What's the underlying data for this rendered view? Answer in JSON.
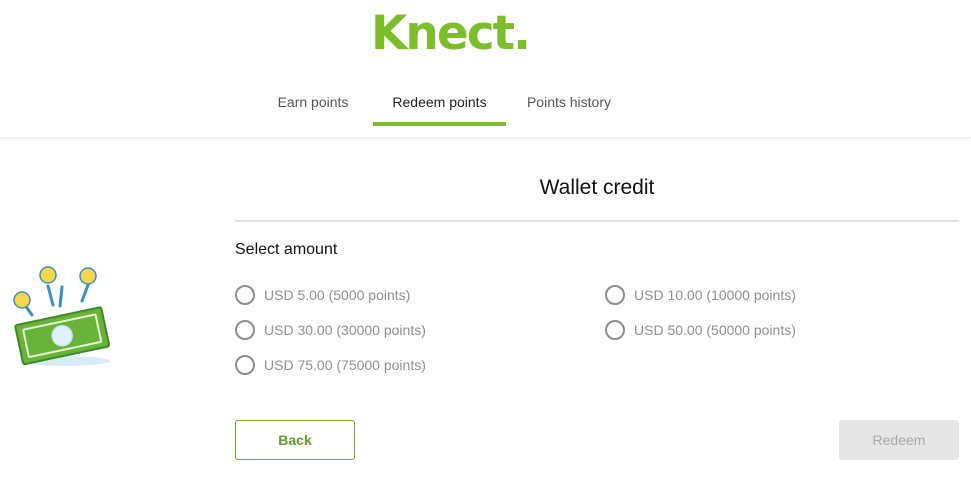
{
  "header": {
    "logo_text": "Knect.",
    "brand_color": "#7cbd2a",
    "tabs": [
      {
        "label": "Earn points",
        "active": false
      },
      {
        "label": "Redeem points",
        "active": true
      },
      {
        "label": "Points history",
        "active": false
      }
    ]
  },
  "main": {
    "illustration": "cash-bill-with-coins-icon",
    "title": "Wallet credit",
    "section_label": "Select amount",
    "options": [
      {
        "label": "USD 5.00 (5000 points)",
        "selected": false
      },
      {
        "label": "USD 10.00 (10000 points)",
        "selected": false
      },
      {
        "label": "USD 30.00 (30000 points)",
        "selected": false
      },
      {
        "label": "USD 50.00 (50000 points)",
        "selected": false
      },
      {
        "label": "USD 75.00 (75000 points)",
        "selected": false
      }
    ],
    "back_label": "Back",
    "redeem_label": "Redeem",
    "redeem_enabled": false
  }
}
